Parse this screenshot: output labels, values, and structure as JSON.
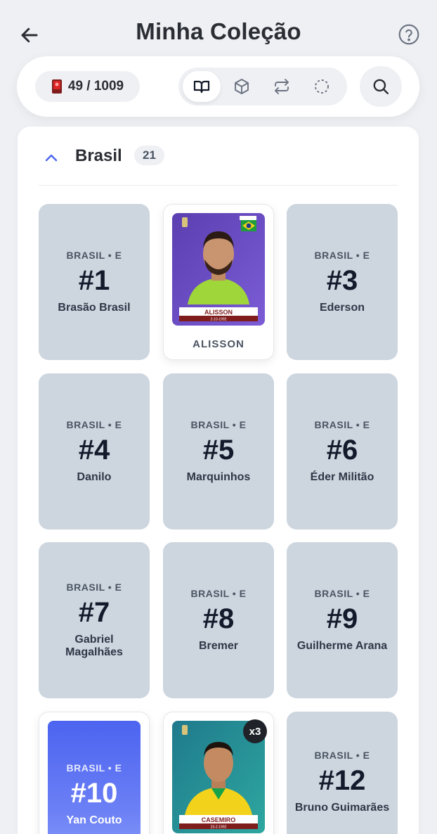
{
  "header": {
    "title": "Minha Coleção",
    "back_icon": "arrow-left-icon",
    "help_icon": "help-circle-icon"
  },
  "toolbar": {
    "collection_count": "49 / 1009",
    "views": [
      {
        "name": "album",
        "icon": "book-open-icon",
        "active": true
      },
      {
        "name": "packs",
        "icon": "box-icon",
        "active": false
      },
      {
        "name": "trades",
        "icon": "repeat-icon",
        "active": false
      },
      {
        "name": "missing",
        "icon": "dashed-circle-icon",
        "active": false
      }
    ],
    "search_icon": "search-icon"
  },
  "section": {
    "team": "Brasil",
    "count": "21"
  },
  "cards": [
    {
      "code": "BRASIL • E",
      "number": "#1",
      "name": "Brasão Brasil",
      "state": "missing"
    },
    {
      "name": "ALISSON",
      "state": "owned",
      "sticker_name": "ALISSON",
      "sticker_date": "2-10-1992",
      "shirt": "#9fd63a"
    },
    {
      "code": "BRASIL • E",
      "number": "#3",
      "name": "Ederson",
      "state": "missing"
    },
    {
      "code": "BRASIL • E",
      "number": "#4",
      "name": "Danilo",
      "state": "missing"
    },
    {
      "code": "BRASIL • E",
      "number": "#5",
      "name": "Marquinhos",
      "state": "missing"
    },
    {
      "code": "BRASIL • E",
      "number": "#6",
      "name": "Éder Militão",
      "state": "missing"
    },
    {
      "code": "BRASIL • E",
      "number": "#7",
      "name": "Gabriel Magalhães",
      "state": "missing"
    },
    {
      "code": "BRASIL • E",
      "number": "#8",
      "name": "Bremer",
      "state": "missing"
    },
    {
      "code": "BRASIL • E",
      "number": "#9",
      "name": "Guilherme Arana",
      "state": "missing"
    },
    {
      "code": "BRASIL • E",
      "number": "#10",
      "name": "Yan Couto",
      "state": "special"
    },
    {
      "state": "owned",
      "sticker_name": "CASEMIRO",
      "sticker_date": "23-2-1992",
      "shirt": "#f2d21b",
      "duplicates": "x3"
    },
    {
      "code": "BRASIL • E",
      "number": "#12",
      "name": "Bruno Guimarães",
      "state": "missing"
    }
  ],
  "colors": {
    "background": "#eef0f4",
    "card_missing": "#cdd5df",
    "accent": "#4c64f0"
  }
}
